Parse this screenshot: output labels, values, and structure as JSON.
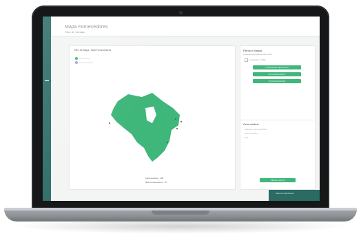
{
  "app": {
    "title": "Mapa Fornecedores",
    "subtitle": "Filtro de Vendas"
  },
  "map_card": {
    "title": "Filtro de Mapa: Total Fornecedores",
    "legend": [
      {
        "label": "Fornecedores",
        "color": "#3fb67a"
      },
      {
        "label": "Sem Fornecedores",
        "color": "#9fa2d6"
      }
    ],
    "stats": {
      "fornecedores": "Fornecedores - 146",
      "nao_fornecedores": "Nao Fornecedores - 76"
    }
  },
  "filter_panel": {
    "title": "Filtros e Mapas",
    "description": "Consulte informações sobre filtros",
    "checkbox_label": "Fornecedores (TBD)",
    "buttons": [
      "CONSULTAR RELATORIO",
      "MOSTRAR DADOS",
      "VISUALIZAR MAPA"
    ]
  },
  "report_panel": {
    "title": "Gerar relatório",
    "lines": [
      "Selecione o tipo de relatório",
      "Tipo de relatório:",
      "CSV"
    ],
    "button_label": "GERAR DADOS"
  },
  "footer": {
    "label": "Mapa Fornecedores"
  },
  "colors": {
    "accent": "#3fb67a",
    "sidebar": "#2b6b64"
  }
}
